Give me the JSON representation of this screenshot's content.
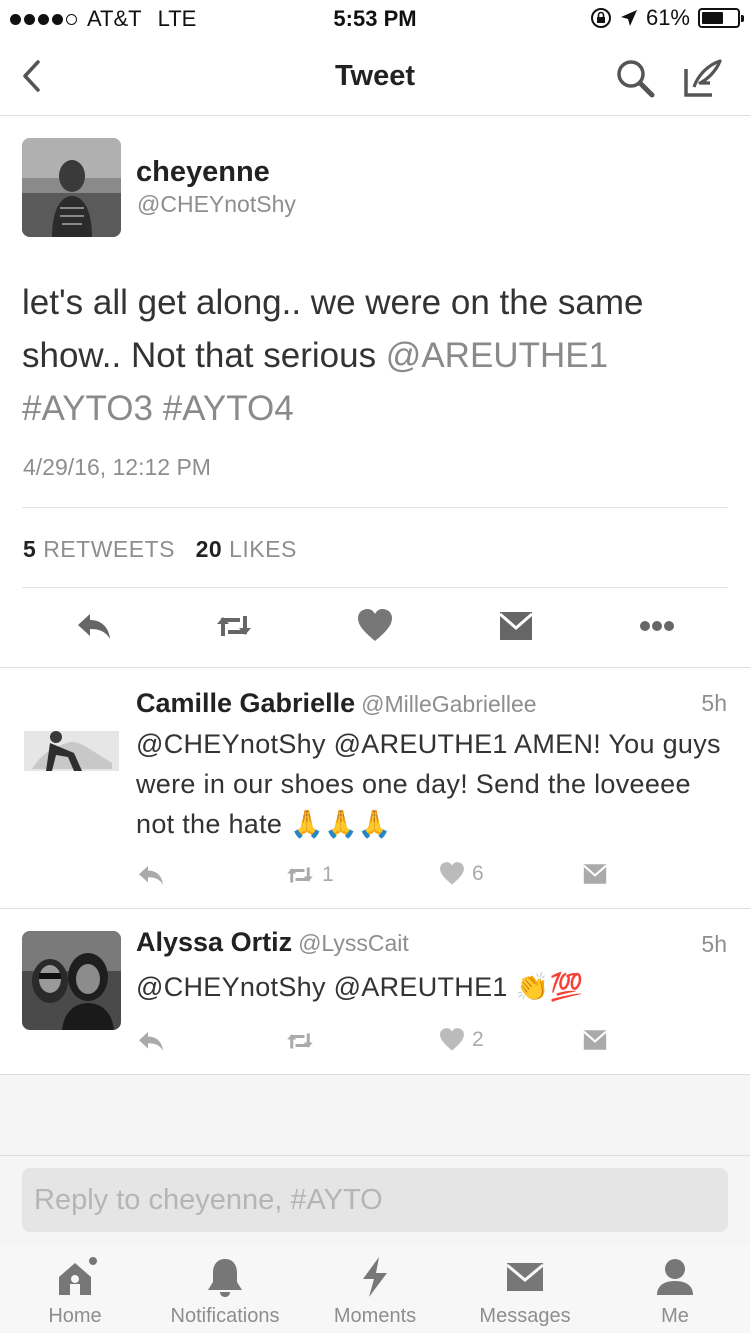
{
  "status_bar": {
    "carrier": "AT&T",
    "network": "LTE",
    "time": "5:53 PM",
    "battery": "61%",
    "battery_level": 0.61
  },
  "nav": {
    "title": "Tweet",
    "icons": [
      "back-icon",
      "search-icon",
      "compose-icon"
    ]
  },
  "tweet": {
    "name": "cheyenne",
    "handle": "@CHEYnotShy",
    "text_plain_1": "let's all get along.. we were on the same show.. Not that serious ",
    "mention": "@AREUTHE1",
    "hashtags": "#AYTO3 #AYTO4",
    "timestamp": "4/29/16, 12:12 PM",
    "retweets_count": "5",
    "retweets_label": "RETWEETS",
    "likes_count": "20",
    "likes_label": "LIKES"
  },
  "replies": [
    {
      "name": "Camille Gabrielle",
      "handle": "@MilleGabriellee",
      "time": "5h",
      "text": "@CHEYnotShy @AREUTHE1 AMEN! You guys were in our shoes one day! Send the loveeee not the hate 🙏🙏🙏",
      "retweets": "1",
      "likes": "6"
    },
    {
      "name": "Alyssa Ortiz",
      "handle": "@LyssCait",
      "time": "5h",
      "text": "@CHEYnotShy @AREUTHE1 👏💯",
      "retweets": "",
      "likes": "2"
    }
  ],
  "reply_box": {
    "placeholder": "Reply to cheyenne, #AYTO"
  },
  "tabs": [
    {
      "label": "Home",
      "icon": "home-icon"
    },
    {
      "label": "Notifications",
      "icon": "bell-icon"
    },
    {
      "label": "Moments",
      "icon": "lightning-icon"
    },
    {
      "label": "Messages",
      "icon": "envelope-icon"
    },
    {
      "label": "Me",
      "icon": "person-icon"
    }
  ],
  "colors": {
    "text": "#222222",
    "secondary": "#8e8e8e",
    "divider": "#dddddd"
  }
}
